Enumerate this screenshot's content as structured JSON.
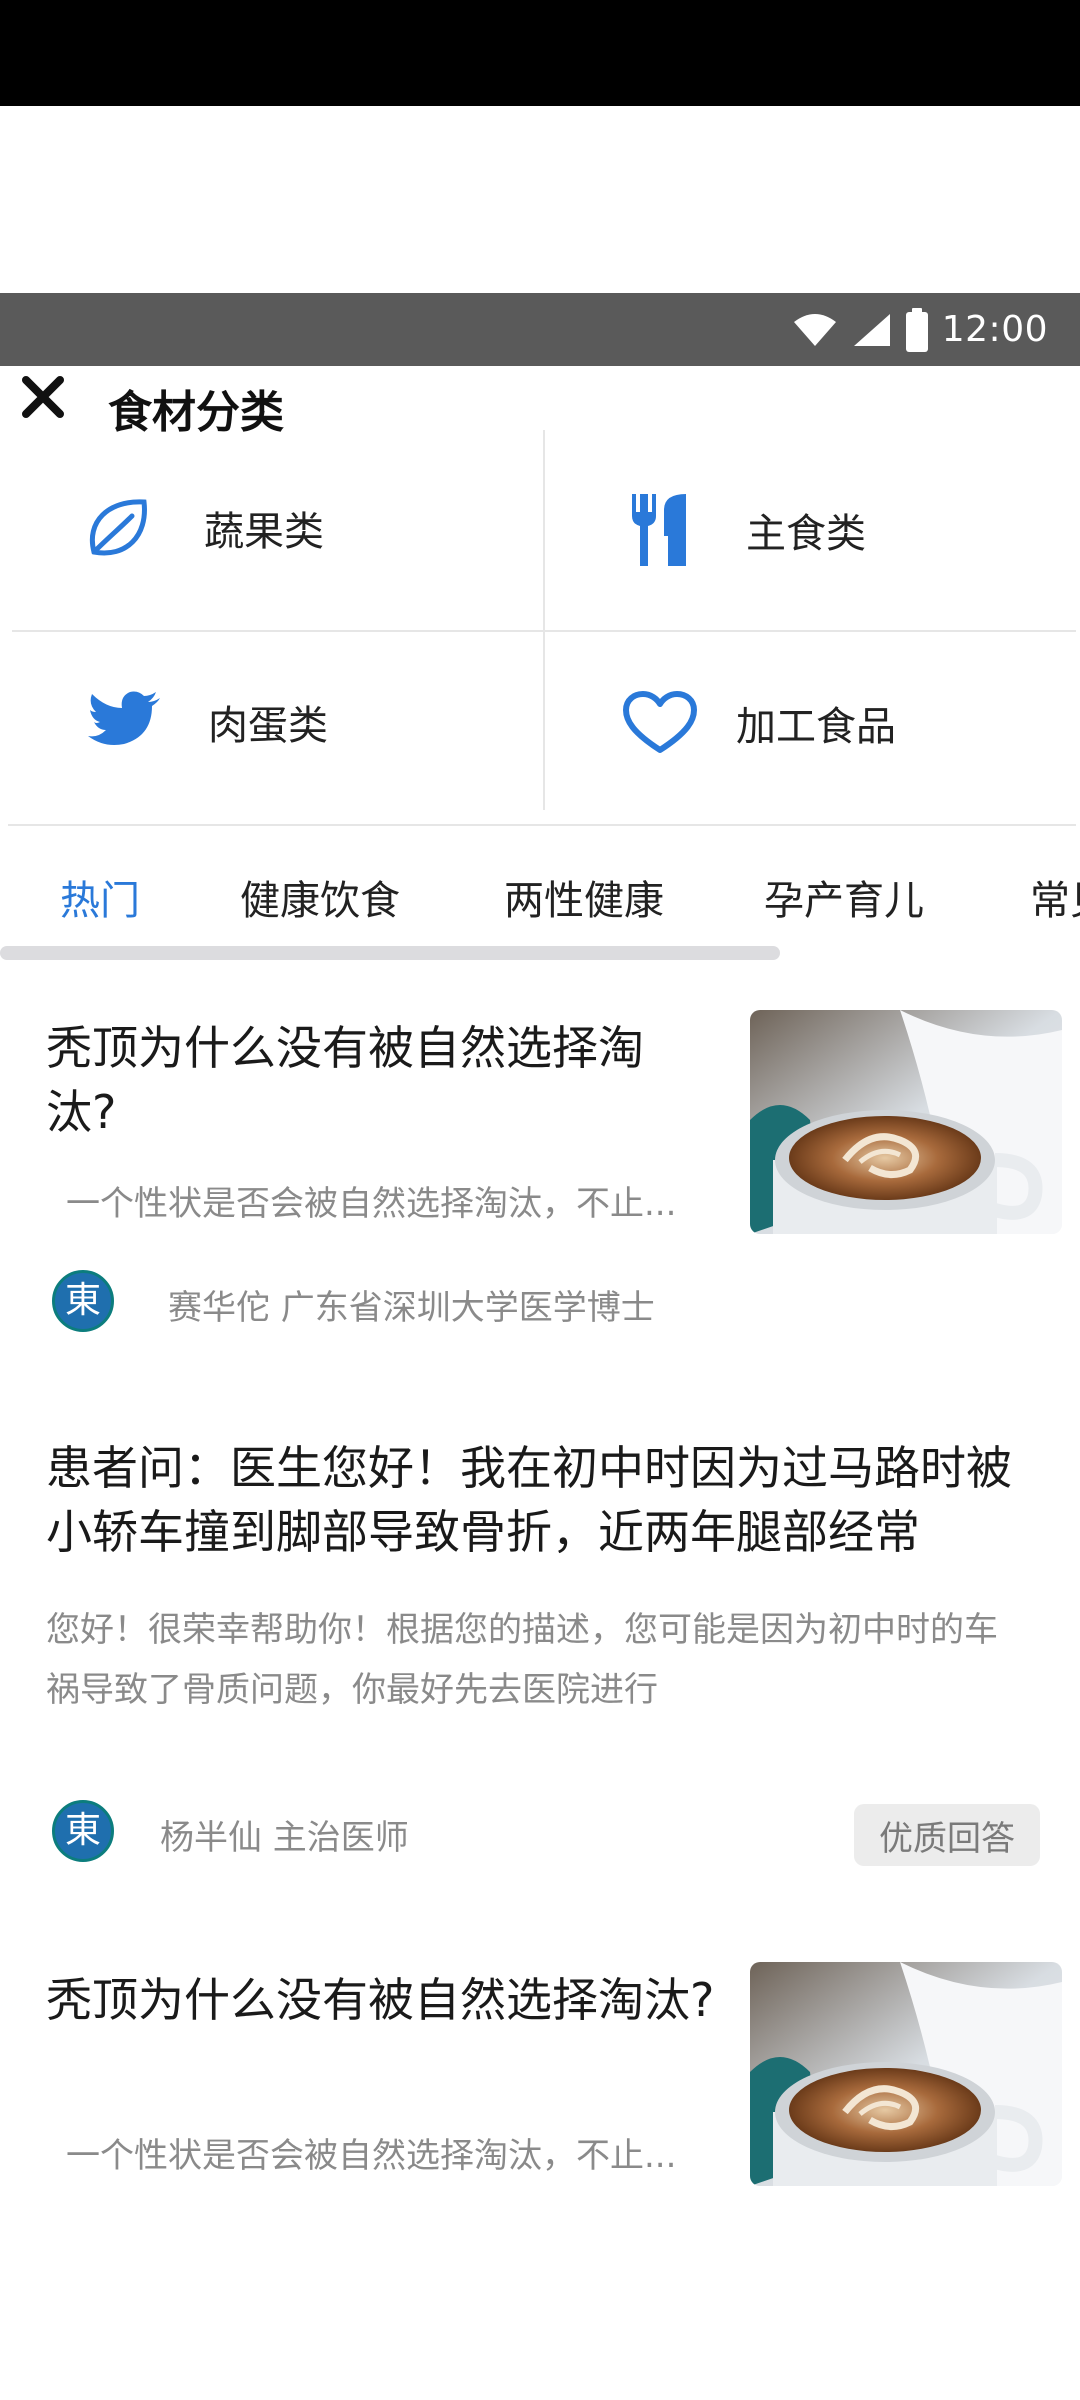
{
  "status_bar": {
    "time": "12:00"
  },
  "header": {
    "title": "食材分类"
  },
  "categories": [
    {
      "label": "蔬果类",
      "icon": "leaf-icon"
    },
    {
      "label": "主食类",
      "icon": "fork-knife-icon"
    },
    {
      "label": "肉蛋类",
      "icon": "bird-icon"
    },
    {
      "label": "加工食品",
      "icon": "heart-icon"
    }
  ],
  "tabs": [
    {
      "label": "热门",
      "active": true
    },
    {
      "label": "健康饮食"
    },
    {
      "label": "两性健康"
    },
    {
      "label": "孕产育儿"
    },
    {
      "label": "常见"
    }
  ],
  "articles": [
    {
      "title": "秃顶为什么没有被自然选择淘汰?",
      "summary": "一个性状是否会被自然选择淘汰，不止...",
      "author": "赛华佗  广东省深圳大学医学博士",
      "avatar_char": "東"
    },
    {
      "title": "患者问：医生您好！我在初中时因为过马路时被小轿车撞到脚部导致骨折，近两年腿部经常",
      "summary": "您好！很荣幸帮助你！根据您的描述，您可能是因为初中时的车祸导致了骨质问题，你最好先去医院进行",
      "author": "杨半仙  主治医师",
      "avatar_char": "東",
      "badge": "优质回答"
    },
    {
      "title": "秃顶为什么没有被自然选择淘汰?",
      "summary": "一个性状是否会被自然选择淘汰，不止..."
    }
  ],
  "colors": {
    "accent": "#2a79d9",
    "muted": "#8a8a8a"
  }
}
